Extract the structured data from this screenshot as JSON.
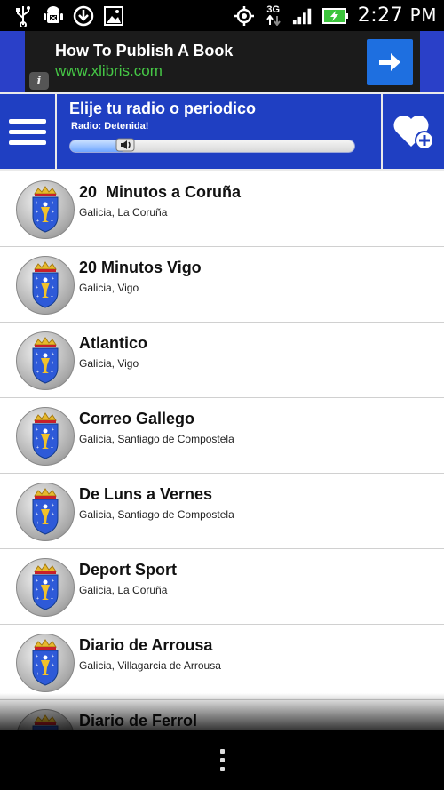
{
  "status_bar": {
    "time": "2:27",
    "time_suffix": "PM",
    "network": "3G",
    "left_icons": [
      "usb-icon",
      "android-debug-icon",
      "download-icon",
      "image-icon"
    ],
    "right_icons": [
      "gps-icon",
      "3g-data-icon",
      "signal-icon",
      "battery-charging-icon"
    ]
  },
  "ad": {
    "title": "How To Publish A Book",
    "url": "www.xlibris.com",
    "info_label": "i"
  },
  "header": {
    "title": "Elije tu radio o periodico",
    "status": "Radio: Detenida!",
    "volume_level": 0.2
  },
  "list": {
    "items": [
      {
        "title": "20  Minutos a Coruña",
        "subtitle": "Galicia, La Coruña"
      },
      {
        "title": "20 Minutos Vigo",
        "subtitle": "Galicia, Vigo"
      },
      {
        "title": "Atlantico",
        "subtitle": "Galicia, Vigo"
      },
      {
        "title": "Correo Gallego",
        "subtitle": "Galicia, Santiago de Compostela"
      },
      {
        "title": "De Luns a Vernes",
        "subtitle": "Galicia, Santiago de Compostela"
      },
      {
        "title": "Deport Sport",
        "subtitle": "Galicia, La Coruña"
      },
      {
        "title": "Diario de Arrousa",
        "subtitle": "Galicia, Villagarcia de Arrousa"
      },
      {
        "title": "Diario de Ferrol",
        "subtitle": ""
      }
    ]
  },
  "colors": {
    "header_blue": "#1f3fc2",
    "ad_green": "#46c846",
    "ad_button_blue": "#1e6fe0"
  }
}
